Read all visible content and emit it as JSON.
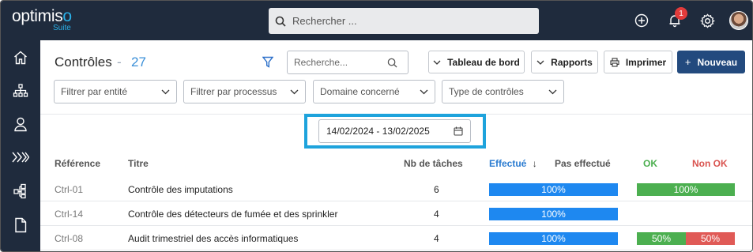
{
  "brand": {
    "logo_prefix": "optimis",
    "logo_accent": "o",
    "logo_sub": "Suite"
  },
  "topbar": {
    "search_placeholder": "Rechercher ...",
    "notification_count": "1"
  },
  "sidebar": {
    "items": [
      {
        "icon": "home-icon"
      },
      {
        "icon": "org-chart-icon"
      },
      {
        "icon": "user-icon"
      },
      {
        "icon": "process-chevrons-icon"
      },
      {
        "icon": "hierarchy-icon"
      },
      {
        "icon": "document-icon"
      }
    ]
  },
  "header": {
    "title": "Contrôles",
    "separator": "-",
    "count": "27",
    "search_placeholder": "Recherche..."
  },
  "toolbar": {
    "dashboard_label": "Tableau de bord",
    "reports_label": "Rapports",
    "print_label": "Imprimer",
    "new_label": "Nouveau"
  },
  "filters": {
    "entity": "Filtrer par entité",
    "process": "Filtrer par processus",
    "domain": "Domaine concerné",
    "type": "Type de contrôles"
  },
  "date_range": {
    "value": "14/02/2024 - 13/02/2025"
  },
  "table": {
    "columns": {
      "reference": "Référence",
      "title": "Titre",
      "tasks": "Nb de tâches",
      "done": "Effectué",
      "sort_indicator": "↓",
      "not_done": "Pas effectué",
      "ok": "OK",
      "not_ok": "Non OK"
    },
    "rows": [
      {
        "reference": "Ctrl-01",
        "title": "Contrôle des imputations",
        "tasks": "6",
        "done_label": "100%",
        "done_fraction": 1.0,
        "ok_label": "100%",
        "ok_fraction": 1.0,
        "not_ok_label": "",
        "not_ok_fraction": 0
      },
      {
        "reference": "Ctrl-14",
        "title": "Contrôle des détecteurs de fumée et des sprinkler",
        "tasks": "4",
        "done_label": "100%",
        "done_fraction": 1.0,
        "ok_label": "",
        "ok_fraction": 0,
        "not_ok_label": "",
        "not_ok_fraction": 0
      },
      {
        "reference": "Ctrl-08",
        "title": "Audit trimestriel des accès informatiques",
        "tasks": "4",
        "done_label": "100%",
        "done_fraction": 1.0,
        "ok_label": "50%",
        "ok_fraction": 0.5,
        "not_ok_label": "50%",
        "not_ok_fraction": 0.5
      }
    ]
  },
  "colors": {
    "navbar": "#1f2b3d",
    "accent": "#2ab0e8",
    "primary_button": "#234a7e",
    "done_bar": "#1e88f0",
    "ok_bar": "#4caf50",
    "not_ok_bar": "#e05a56",
    "highlight_box": "#1ea3dc"
  }
}
